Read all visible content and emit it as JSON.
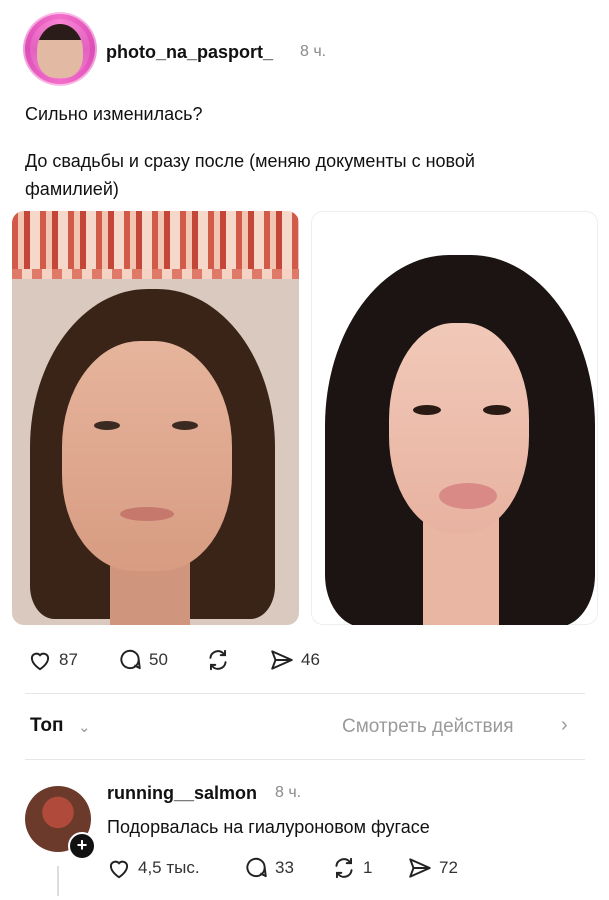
{
  "post": {
    "username": "photo_na_pasport_",
    "time": "8 ч.",
    "text_line1": "Сильно изменилась?",
    "text_line2": "До свадьбы и сразу после (меняю документы с новой фамилией)",
    "actions": {
      "likes": "87",
      "comments": "50",
      "reposts": "",
      "shares": "46"
    }
  },
  "filter": {
    "sort_label": "Топ",
    "view_activity": "Смотреть действия"
  },
  "comment": {
    "username": "running__salmon",
    "time": "8 ч.",
    "text": "Подорвалась на гиалуроновом фугасе",
    "actions": {
      "likes": "4,5 тыс.",
      "comments": "33",
      "reposts": "1",
      "shares": "72"
    }
  },
  "icons": {
    "heart": "heart-icon",
    "comment": "comment-icon",
    "repost": "repost-icon",
    "share": "share-icon",
    "chevron": "chevron-icon",
    "plus": "plus-icon"
  }
}
